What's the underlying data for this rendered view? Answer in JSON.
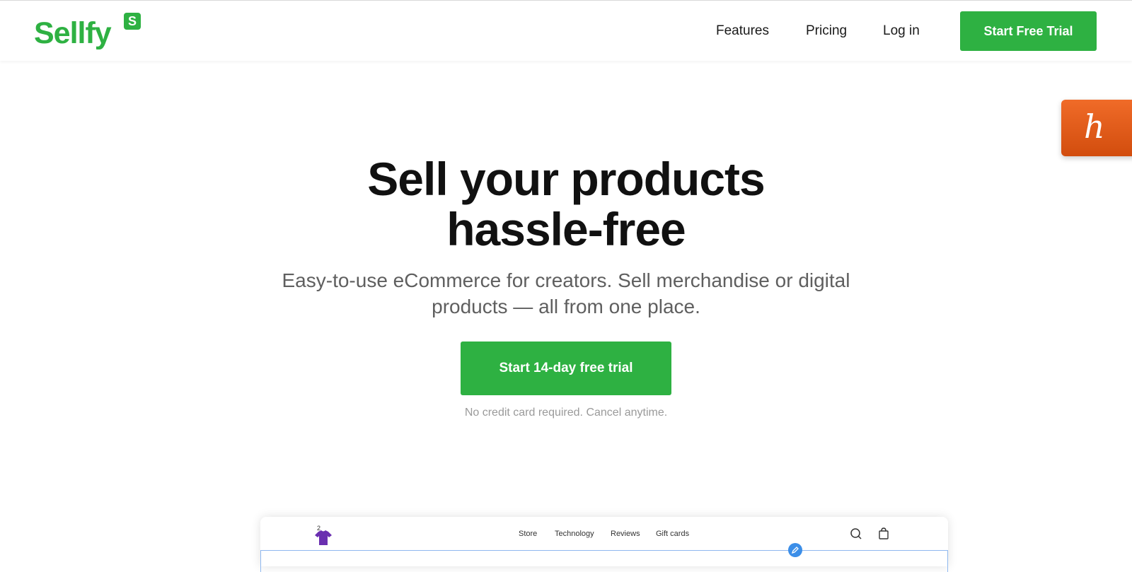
{
  "brand": {
    "name": "Sellfy",
    "badge": "S",
    "color": "#2eb142"
  },
  "nav": {
    "links": [
      "Features",
      "Pricing",
      "Log in"
    ],
    "cta": "Start Free Trial"
  },
  "honey_widget": {
    "glyph": "h",
    "icon": "honey-extension-icon"
  },
  "hero": {
    "title_line1": "Sell your products",
    "title_line2": "hassle-free",
    "subtitle_line1": "Easy-to-use eCommerce for creators. Sell merchandise or digital",
    "subtitle_line2": "products — all from one place.",
    "cta": "Start 14-day free trial",
    "note": "No credit card required. Cancel anytime."
  },
  "preview": {
    "cart_count": "2",
    "nav_items": [
      "Store",
      "Technology",
      "Reviews",
      "Gift cards"
    ],
    "icons": [
      "tshirt-icon",
      "search-icon",
      "cart-icon",
      "edit-icon"
    ]
  }
}
